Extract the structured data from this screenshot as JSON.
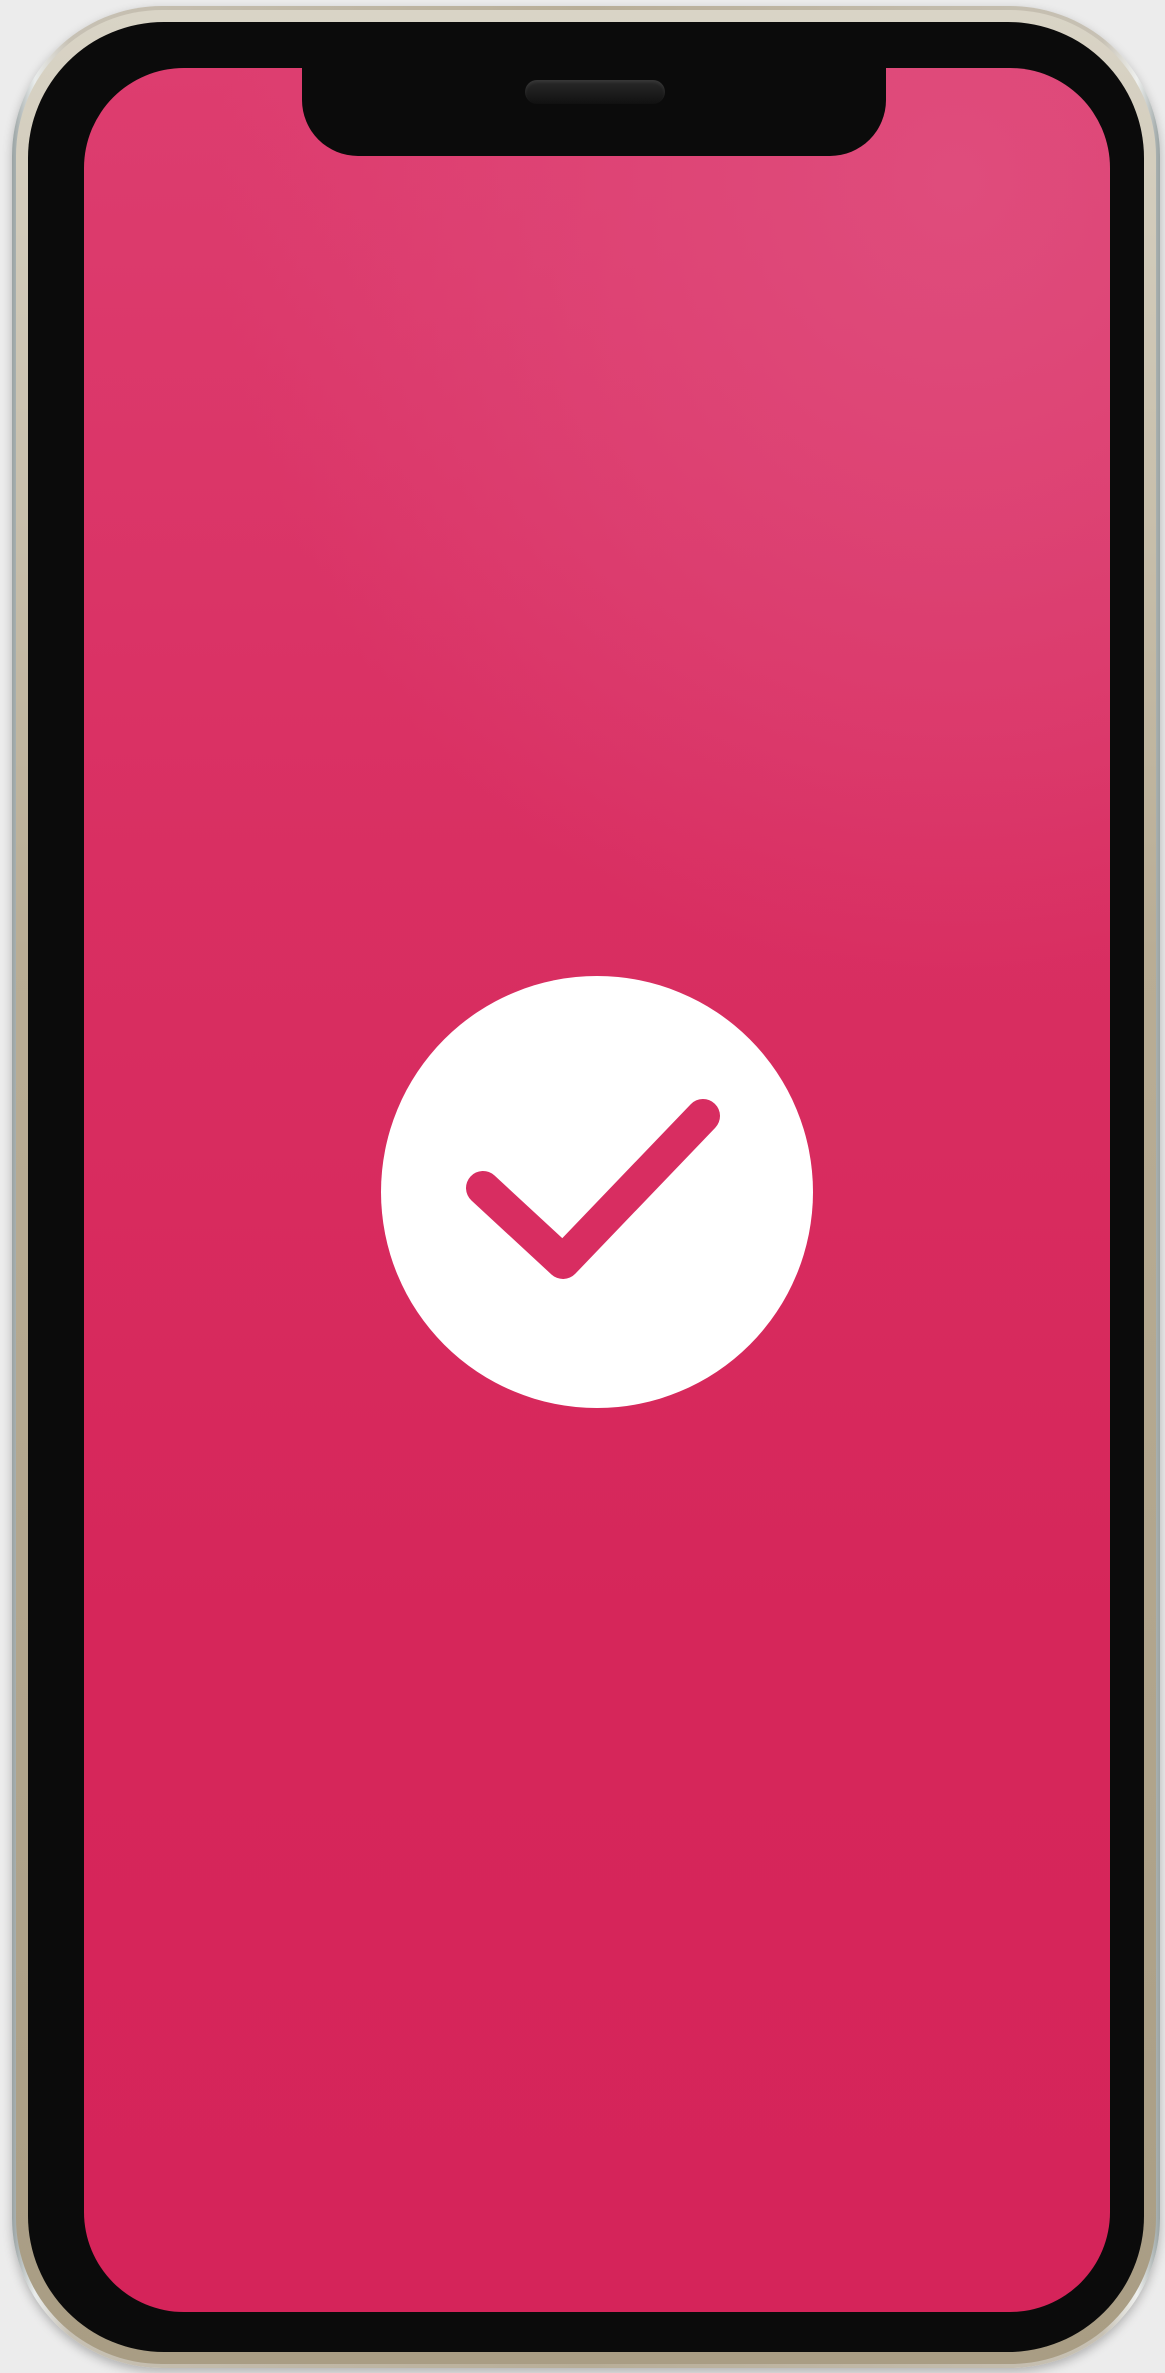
{
  "app": {
    "screen_state": "success"
  },
  "device": {
    "type": "smartphone",
    "frame_color": "#bcae95",
    "bezel_color": "#0b0b0b"
  },
  "screen": {
    "background_color_top": "#dd3d6f",
    "background_color_bottom": "#d5245a"
  },
  "success_indicator": {
    "icon": "checkmark-icon",
    "circle_color": "#ffffff",
    "check_color": "#d82d61"
  }
}
